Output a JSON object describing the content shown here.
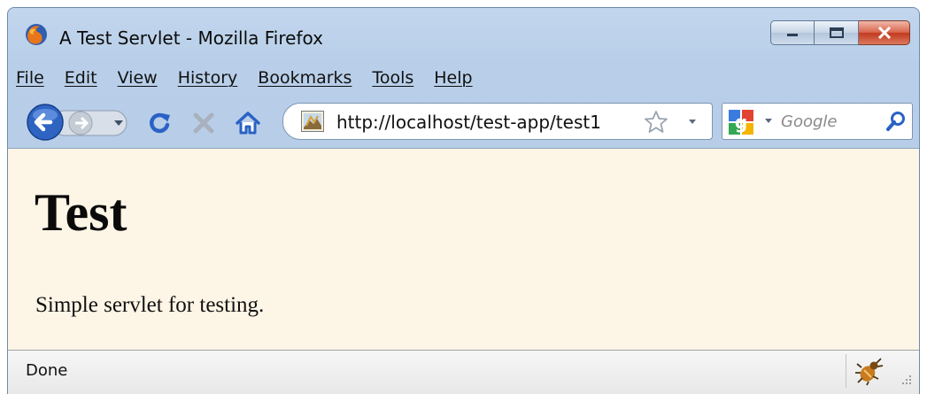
{
  "window": {
    "title": "A Test Servlet - Mozilla Firefox"
  },
  "menu": {
    "items": [
      "File",
      "Edit",
      "View",
      "History",
      "Bookmarks",
      "Tools",
      "Help"
    ]
  },
  "navigation": {
    "url": "http://localhost/test-app/test1"
  },
  "search": {
    "placeholder": "Google"
  },
  "page": {
    "heading": "Test",
    "paragraph": "Simple servlet for testing.",
    "background_color": "#fdf5e6"
  },
  "status": {
    "text": "Done"
  },
  "icons": {
    "app": "firefox-logo-icon",
    "back": "back-arrow-icon",
    "forward": "forward-arrow-icon",
    "history_dropdown": "chevron-down-icon",
    "reload": "reload-icon",
    "stop": "stop-icon",
    "home": "home-icon",
    "favicon": "page-favicon-icon",
    "bookmark": "star-icon",
    "url_dropdown": "chevron-down-icon",
    "search_engine": "google-icon",
    "search_go": "magnifier-icon",
    "status_addon": "firebug-icon",
    "resize": "resize-grip-icon"
  },
  "colors": {
    "accent_blue": "#3a6fc0",
    "close_red": "#c2391e",
    "chrome_blue": "#b9cfe9"
  }
}
